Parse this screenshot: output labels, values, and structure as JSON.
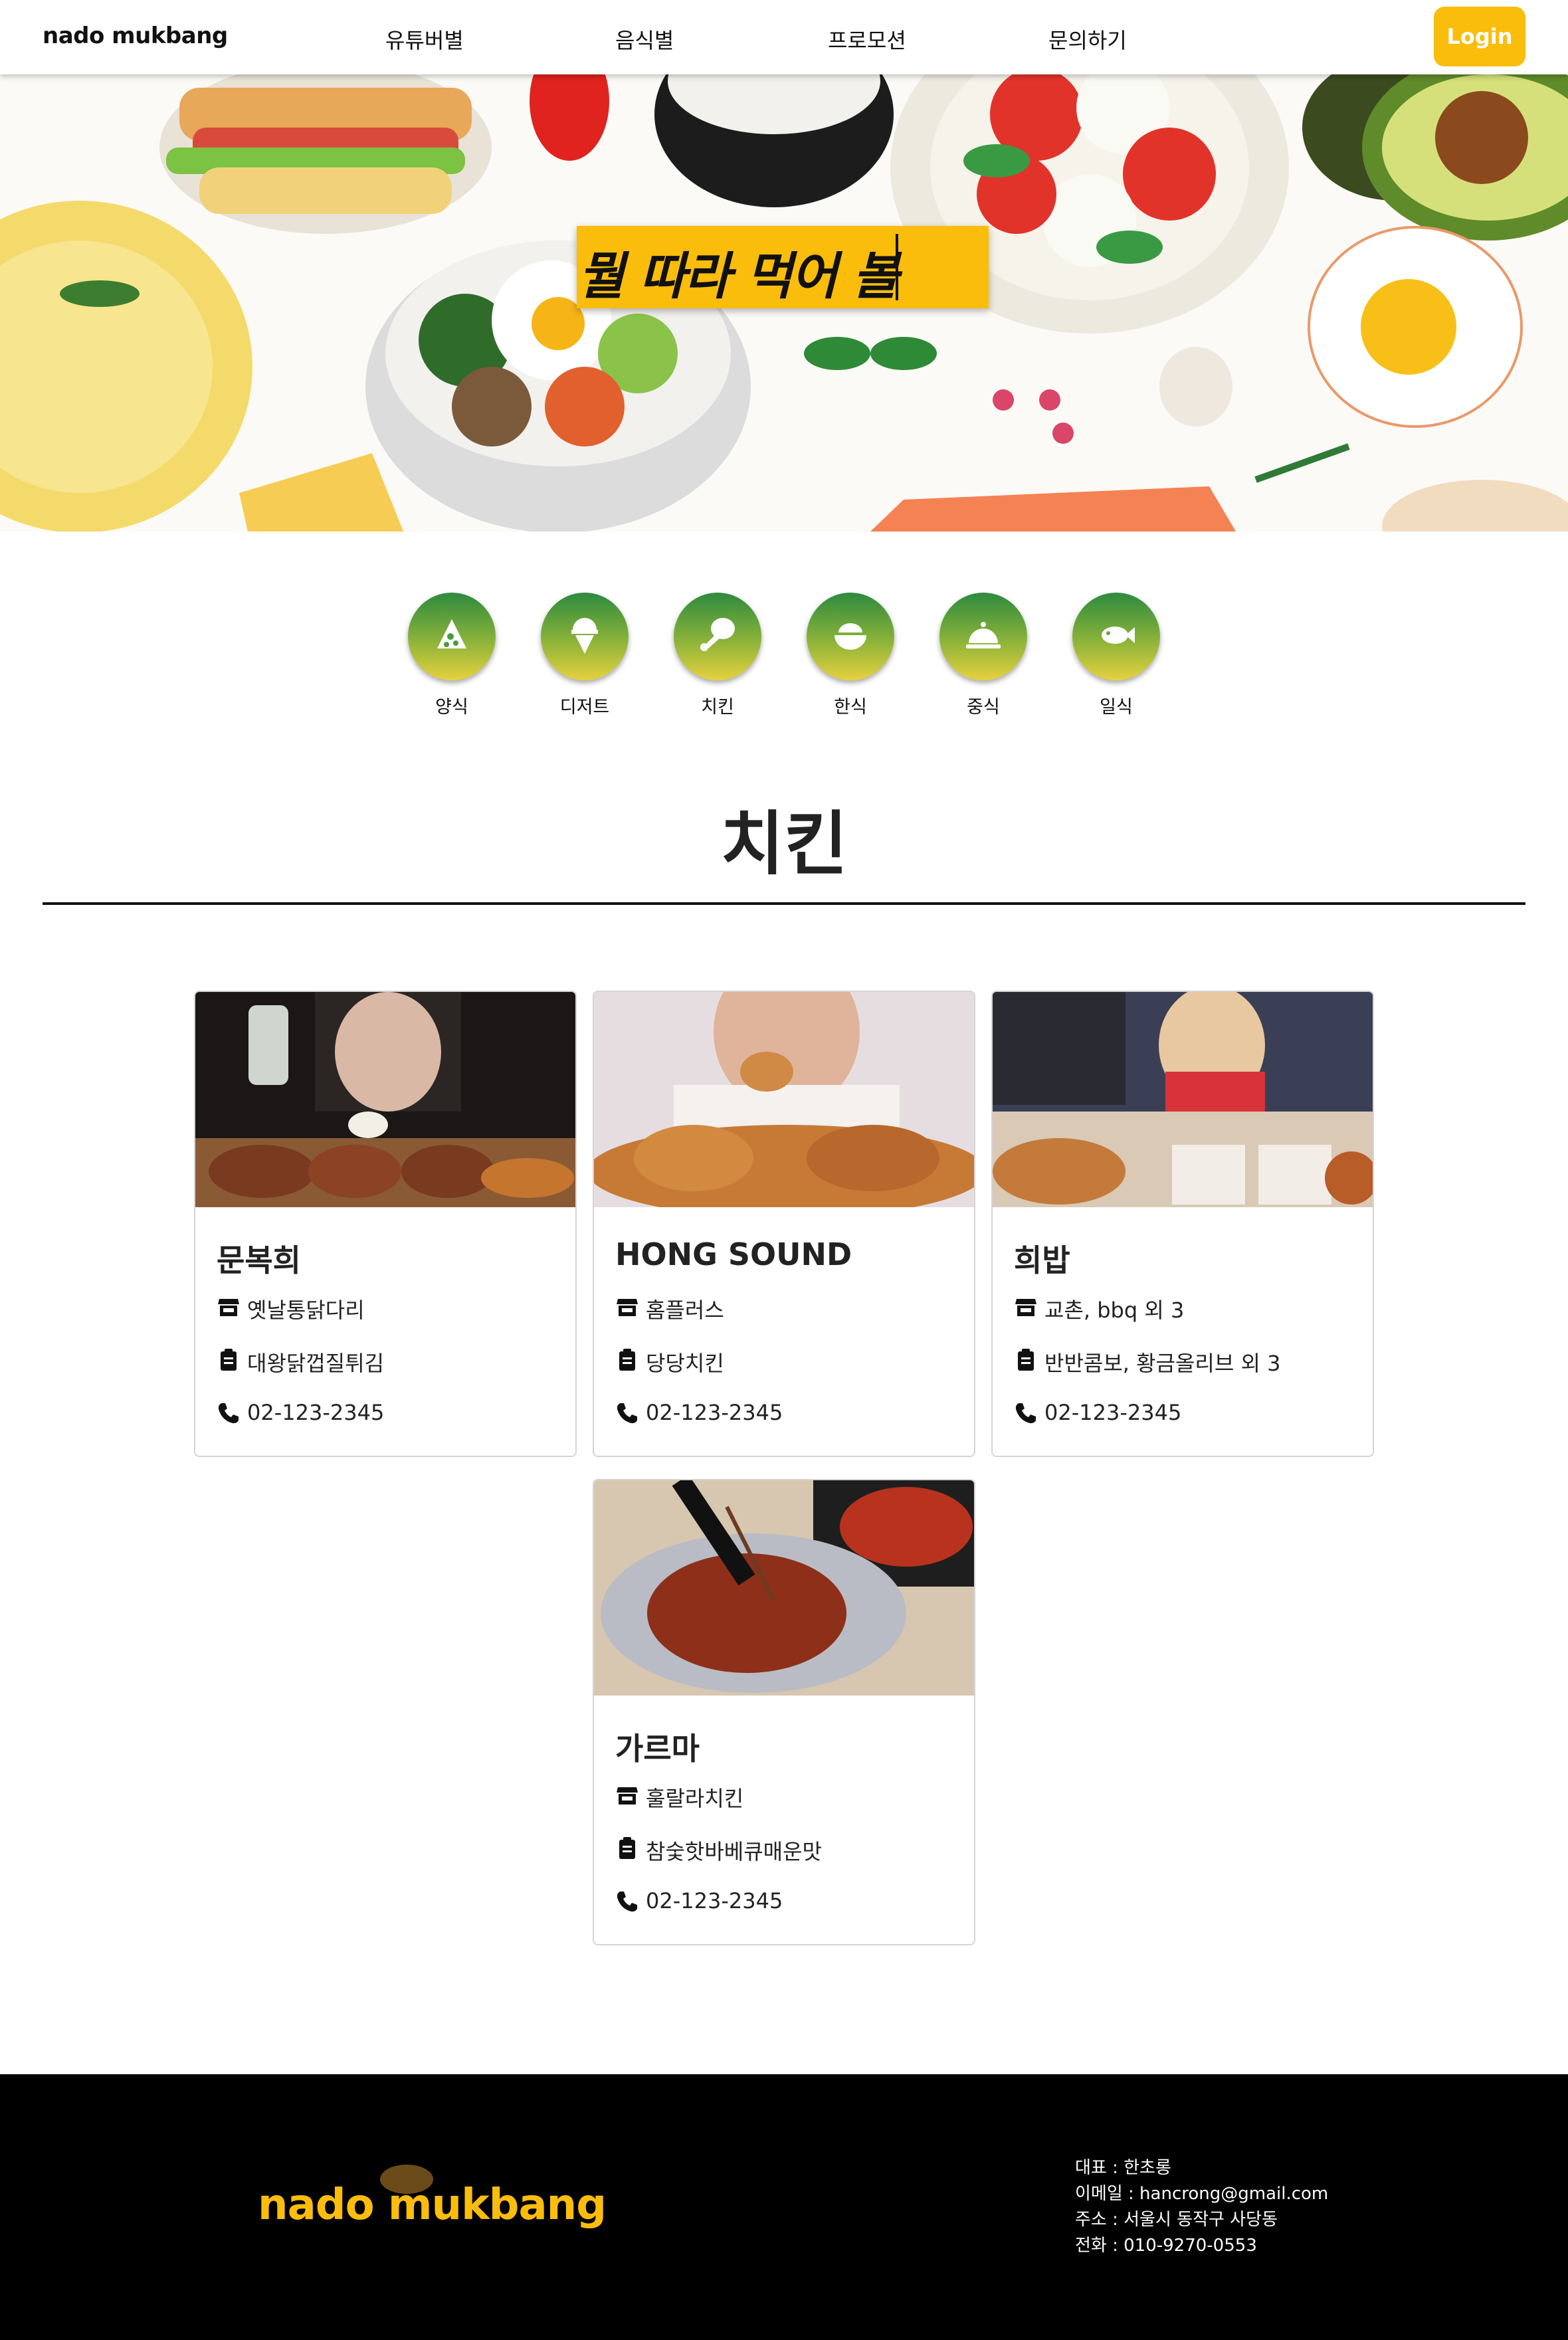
{
  "nav": {
    "logo": "nado mukbang",
    "menu": [
      "유튜버별",
      "음식별",
      "프로모션",
      "문의하기"
    ],
    "login_label": "Login"
  },
  "hero": {
    "search_text": "뭘 따라 먹어 볼"
  },
  "categories": [
    {
      "label": "양식",
      "icon": "pizza-icon"
    },
    {
      "label": "디저트",
      "icon": "ice-cream-icon"
    },
    {
      "label": "치킨",
      "icon": "drumstick-icon"
    },
    {
      "label": "한식",
      "icon": "rice-bowl-icon"
    },
    {
      "label": "중식",
      "icon": "cloche-icon"
    },
    {
      "label": "일식",
      "icon": "fish-icon"
    }
  ],
  "section": {
    "title": "치킨"
  },
  "cards": [
    {
      "name": "문복희",
      "brand": "옛날통닭다리",
      "menu": "대왕닭껍질튀김",
      "phone": "02-123-2345"
    },
    {
      "name": "HONG SOUND",
      "brand": "홈플러스",
      "menu": "당당치킨",
      "phone": "02-123-2345"
    },
    {
      "name": "희밥",
      "brand": "교촌, bbq 외 3",
      "menu": "반반콤보, 황금올리브 외 3",
      "phone": "02-123-2345"
    },
    {
      "name": "가르마",
      "brand": "훌랄라치킨",
      "menu": "참숯핫바베큐매운맛",
      "phone": "02-123-2345"
    }
  ],
  "icons": {
    "store": "store-icon",
    "menu": "clipboard-icon",
    "phone": "phone-icon"
  },
  "footer": {
    "logo": "nado mukbang",
    "info": [
      "대표 : 한초롱",
      "이메일 : hancrong@gmail.com",
      "주소 : 서울시 동작구 사당동",
      "전화 : 010-9270-0553"
    ]
  },
  "colors": {
    "accent": "#fbbd0c",
    "category_top": "#2d8a3e",
    "category_bottom": "#e6d13e",
    "footer_bg": "#000000"
  }
}
